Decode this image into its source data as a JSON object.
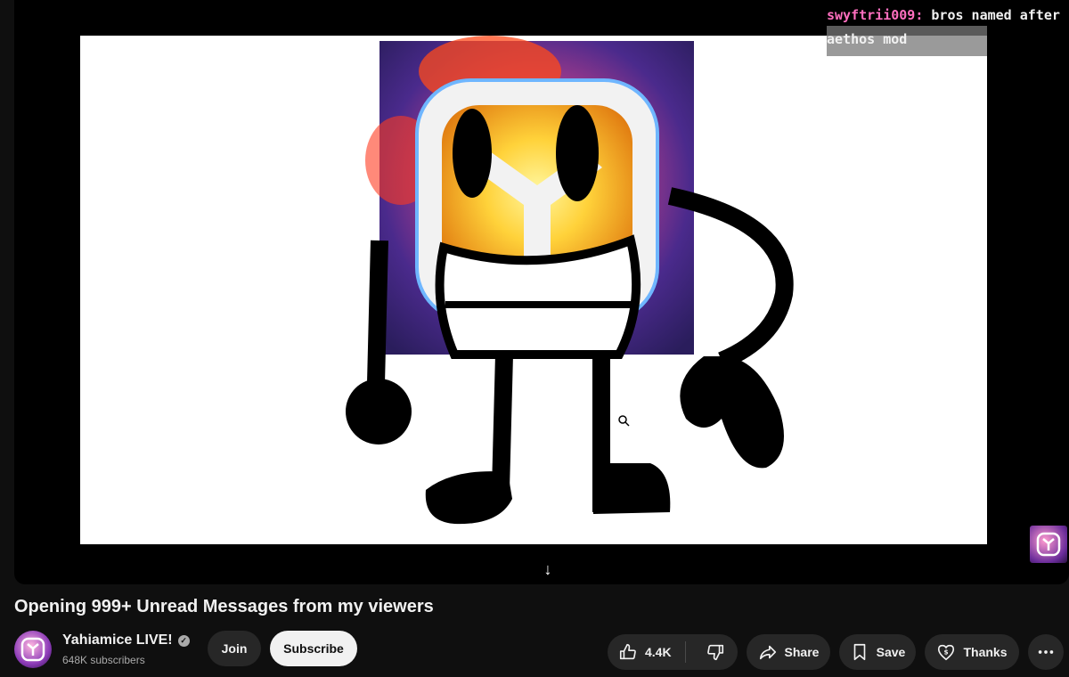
{
  "video": {
    "title": "Opening 999+ Unread Messages from my viewers"
  },
  "chat_overlay": {
    "username": "swyftrii009",
    "message": "bros named after aethos mod"
  },
  "channel": {
    "name": "Yahiamice LIVE!",
    "subscribers": "648K subscribers"
  },
  "actions": {
    "join": "Join",
    "subscribe": "Subscribe",
    "likes": "4.4K",
    "share": "Share",
    "save": "Save",
    "thanks": "Thanks"
  },
  "icons": {
    "like": "thumbs-up-icon",
    "dislike": "thumbs-down-icon",
    "share": "share-arrow-icon",
    "save": "bookmark-icon",
    "thanks": "heart-dollar-icon",
    "more": "more-horizontal-icon",
    "scroll": "arrow-down-icon",
    "verified": "check-circle-icon"
  },
  "colors": {
    "background": "#0f0f0f",
    "pill": "#272727",
    "subscribe_bg": "#f1f1f1",
    "chat_username": "#ff6fbf"
  }
}
